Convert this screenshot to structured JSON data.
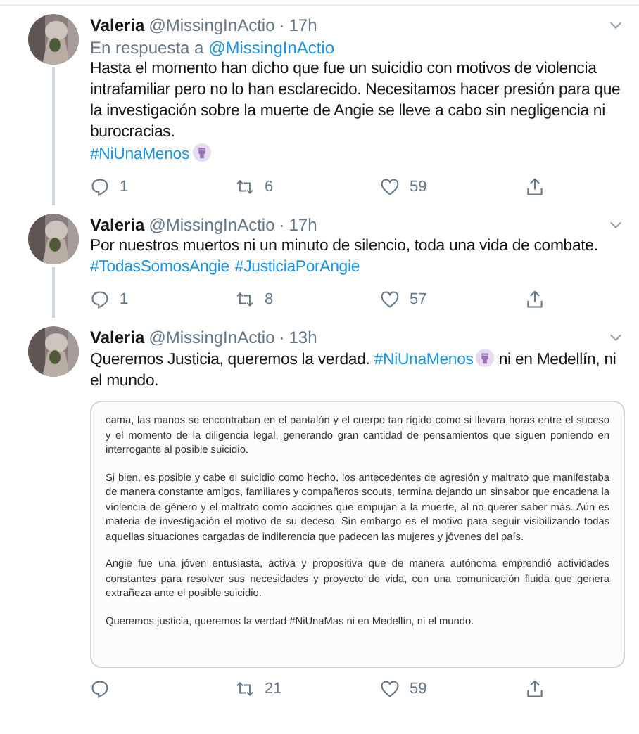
{
  "tweets": [
    {
      "name": "Valeria",
      "handle": "@MissingInActio",
      "separator": "·",
      "time": "17h",
      "reply_to": {
        "prefix": "En respuesta a",
        "handle": "@MissingInActio"
      },
      "body": [
        [
          {
            "kind": "text",
            "text": "Hasta el momento han dicho que fue un suicidio con motivos de violencia intrafamiliar pero no lo han esclarecido. Necesitamos hacer presión para que la investigación sobre la muerte de Angie se lleve a cabo sin negligencia ni burocracias."
          }
        ],
        [
          {
            "kind": "link",
            "text": "#NiUnaMenos"
          },
          {
            "kind": "emoji"
          }
        ]
      ],
      "actions": {
        "replies": "1",
        "retweets": "6",
        "likes": "59"
      }
    },
    {
      "name": "Valeria",
      "handle": "@MissingInActio",
      "separator": "·",
      "time": "17h",
      "body": [
        [
          {
            "kind": "text",
            "text": "Por nuestros muertos ni un minuto de silencio, toda una vida de combate."
          }
        ],
        [
          {
            "kind": "link",
            "text": "#TodasSomosAngie"
          },
          {
            "kind": "link",
            "text": "#JusticiaPorAngie"
          }
        ]
      ],
      "actions": {
        "replies": "1",
        "retweets": "8",
        "likes": "57"
      }
    },
    {
      "name": "Valeria",
      "handle": "@MissingInActio",
      "separator": "·",
      "time": "13h",
      "body": [
        [
          {
            "kind": "text",
            "text": "Queremos Justicia, queremos la verdad. "
          },
          {
            "kind": "link",
            "text": "#NiUnaMenos"
          },
          {
            "kind": "emoji"
          },
          {
            "kind": "text",
            "text": " ni en Medellín, ni el mundo."
          }
        ]
      ],
      "attachment": {
        "kind": "document",
        "paragraphs": [
          "cama, las manos se encontraban en el pantalón y el cuerpo tan rígido como si llevara horas entre el suceso y el momento de la diligencia legal, generando gran cantidad de pensamientos que siguen poniendo en interrogante al posible suicidio.",
          "Si bien, es posible y cabe el suicidio como hecho, los antecedentes de agresión y maltrato que manifestaba de manera constante amigos, familiares y compañeros scouts, termina dejando un sinsabor que encadena la violencia de género y el maltrato como acciones que empujan a la muerte, al no querer saber más. Aún es materia de investigación el motivo de su deceso. Sin embargo es el motivo para seguir visibilizando todas aquellas situaciones cargadas de indiferencia que padecen las mujeres y jóvenes del país.",
          "Angie fue una jóven entusiasta, activa y propositiva que de manera autónoma emprendió actividades constantes para resolver sus necesidades y proyecto de vida, con una comunicación fluida que genera extrañeza ante el posible suicidio.",
          "Queremos justicia, queremos la verdad #NiUnaMas ni en Medellín, ni el mundo."
        ]
      },
      "actions": {
        "retweets": "21",
        "likes": "59"
      }
    }
  ]
}
